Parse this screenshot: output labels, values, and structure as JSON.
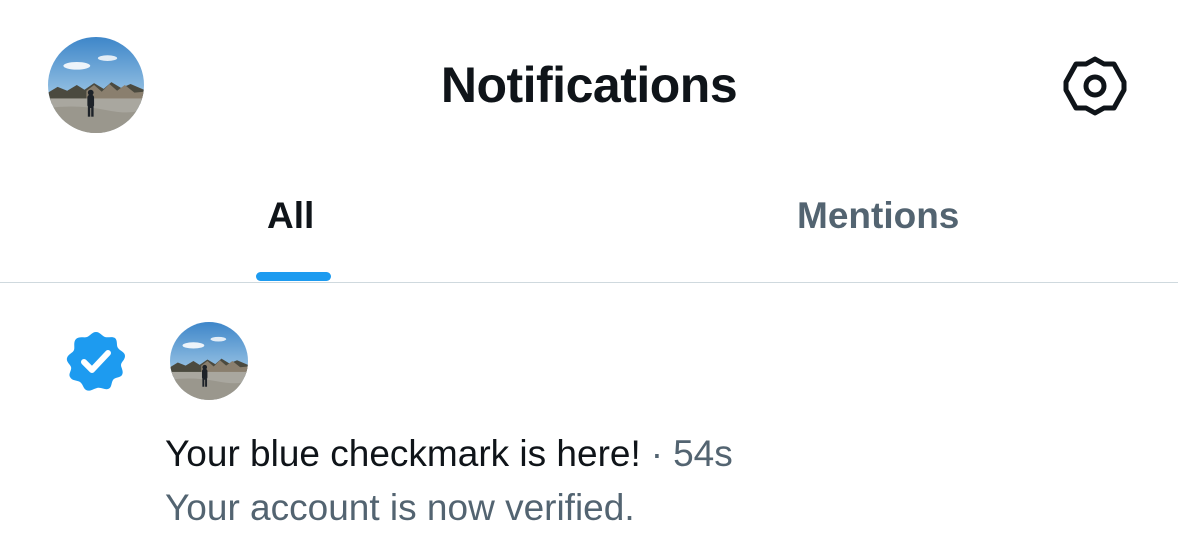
{
  "header": {
    "title": "Notifications",
    "profile_avatar_icon": "profile-photo-avatar",
    "settings_icon": "gear-icon"
  },
  "tabs": [
    {
      "label": "All",
      "selected": true
    },
    {
      "label": "Mentions",
      "selected": false
    }
  ],
  "notifications": [
    {
      "icon": "verified-badge-icon",
      "avatar_icon": "profile-photo-avatar",
      "title": "Your blue checkmark is here!",
      "separator": "·",
      "time": "54s",
      "body": "Your account is now verified."
    }
  ],
  "colors": {
    "accent": "#1d9bf0",
    "text_primary": "#0f1419",
    "text_secondary": "#536471",
    "divider": "#cfd9de"
  }
}
